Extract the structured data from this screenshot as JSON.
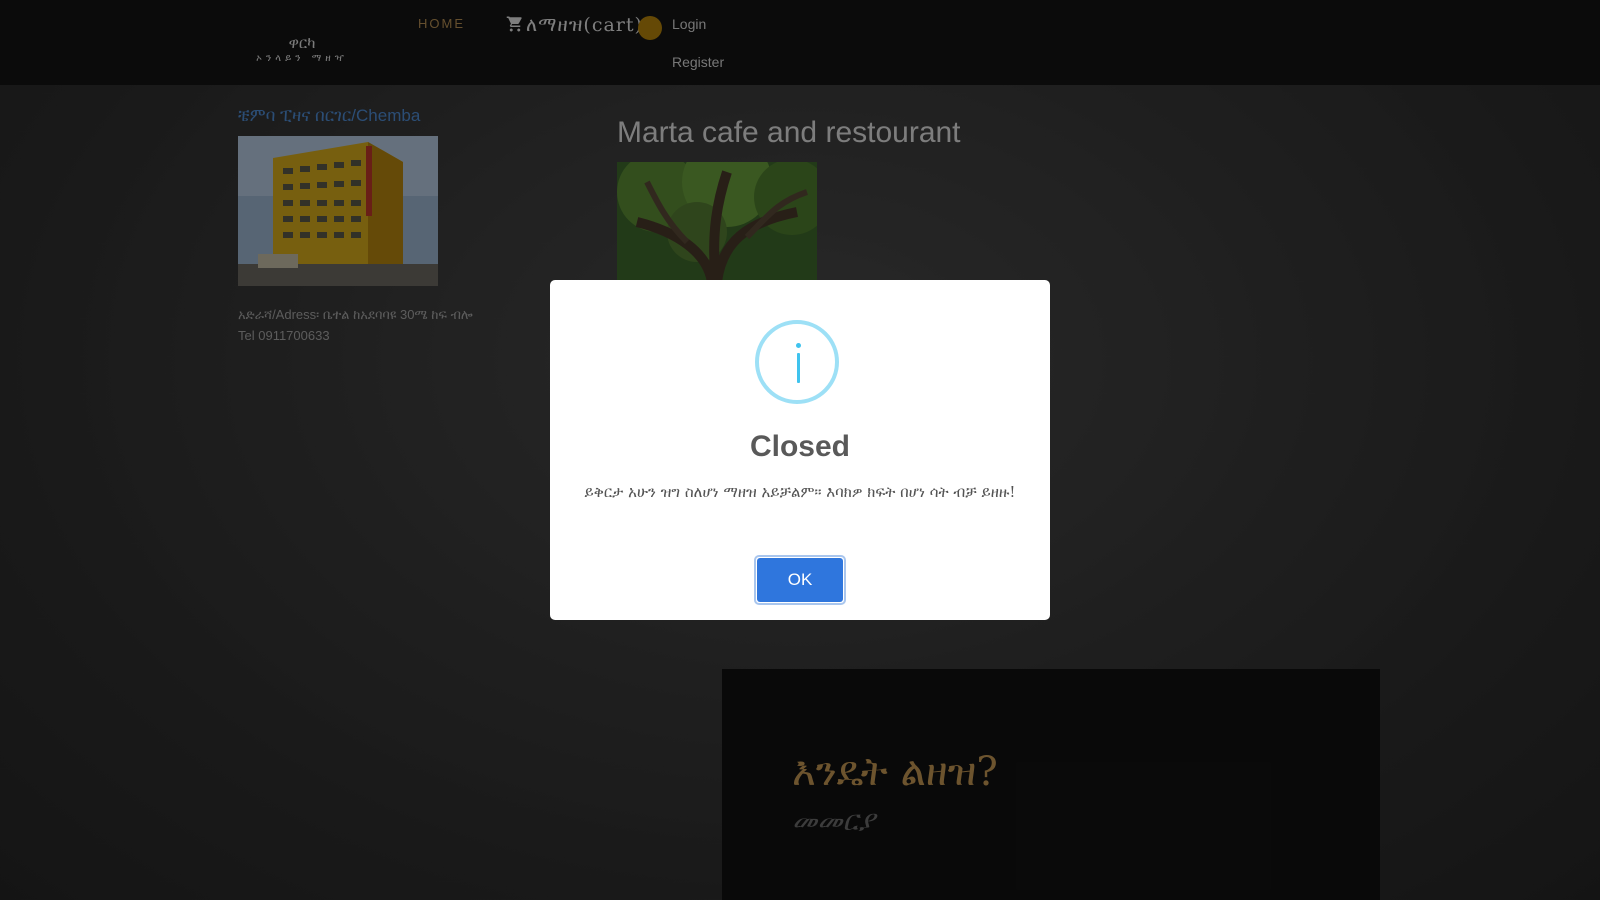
{
  "navbar": {
    "brand_title": "ዋርካ",
    "brand_subtitle": "ኦንላይን ማዘዣ",
    "home_label": "HOME",
    "cart_label": "ለማዘዝ(cart)",
    "login_label": "Login",
    "register_label": "Register",
    "cart_icon": "shopping-cart-icon",
    "badge_color": "#b8860b"
  },
  "listing": {
    "left_store": {
      "name": "ቼምባ ፒዛና በርገር/Chemba",
      "address": "አድራሻ/Adress፡ ቤተል ከአደባባዩ 30ሜ ከፍ ብሎ",
      "phone": "Tel 0911700633"
    },
    "right_store": {
      "name": "Marta cafe and restourant"
    }
  },
  "howto": {
    "title": "እንዴት ልዘዝ?",
    "subtitle": "መመርያ"
  },
  "modal": {
    "icon": "info-icon",
    "title": "Closed",
    "message": "ይቅርታ አሁን ዝግ ስለሆነ ማዘዝ አይቻልም። እባክዎ ክፍት በሆነ ሳት ብቻ ይዘዙ!",
    "ok_label": "OK",
    "accent_color": "#2f76dd"
  }
}
